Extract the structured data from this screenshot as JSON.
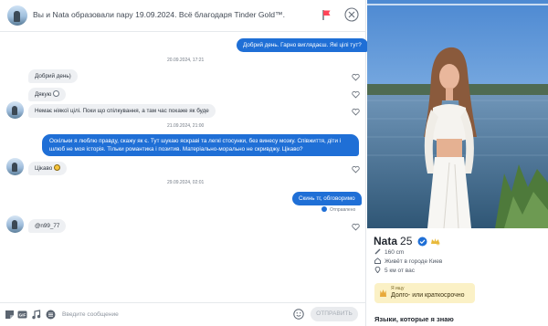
{
  "header": {
    "match_title": "Вы и Nata образовали пару 19.09.2024. Всё благодаря Tinder Gold™.",
    "report_icon": "flag-icon",
    "close_icon": "close-circle-icon"
  },
  "messages": [
    {
      "side": "out",
      "text": "Добрий день. Гарно виглядаєш. Які цілі тут?"
    },
    {
      "side": "timestamp",
      "text": "20.09.2024, 17:21"
    },
    {
      "side": "in",
      "text": "Добрий день)"
    },
    {
      "side": "in",
      "text": "Дякую"
    },
    {
      "side": "in",
      "text": "Немає ніякої цілі. Поки що спілкування, а там час покаже як буде"
    },
    {
      "side": "timestamp",
      "text": "21.09.2024, 21:00"
    },
    {
      "side": "out",
      "text": "Оскільки я люблю правду, скажу як є. Тут шукаю яскраві та легкі стосунки, без винесу мозку. Співжиття, діти і шлюб не моя історія. Тільки романтика і позитив. Матеріально-морально не скривджу. Цікаво?"
    },
    {
      "side": "in",
      "text": "Цікаво"
    },
    {
      "side": "timestamp",
      "text": "29.09.2024, 02:01"
    },
    {
      "side": "out",
      "text": "Скинь тг, обговоримо"
    },
    {
      "side": "status",
      "text": "Отправлено"
    },
    {
      "side": "in",
      "text": "@n99_77"
    }
  ],
  "composer": {
    "placeholder": "Введите сообщение",
    "send_label": "ОТПРАВИТЬ",
    "icons": [
      "sticker-icon",
      "gif-icon",
      "music-icon",
      "menu-icon",
      "emoji-icon"
    ]
  },
  "profile": {
    "name": "Nata",
    "age": "25",
    "height": "160 cm",
    "city": "Живёт в городе Киев",
    "distance": "5 км от вас",
    "goal_label": "Я ищу",
    "goal_value": "Долго- или краткосрочно",
    "languages_heading": "Языки, которые я знаю"
  },
  "colors": {
    "accent_blue": "#1f6fd6",
    "incoming_bubble": "#eef0f3",
    "goal_card": "#fbf1c6"
  }
}
